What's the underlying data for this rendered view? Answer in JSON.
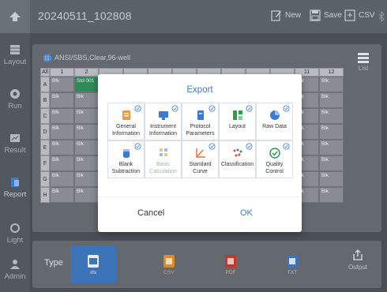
{
  "header": {
    "title": "20240511_102808",
    "new_label": "New",
    "save_label": "Save",
    "csv_label": "CSV"
  },
  "sidebar": {
    "items": [
      {
        "label": "Layout",
        "icon": "layout-icon"
      },
      {
        "label": "Run",
        "icon": "run-icon"
      },
      {
        "label": "Result",
        "icon": "result-icon"
      },
      {
        "label": "Report",
        "icon": "report-icon"
      },
      {
        "label": "Light",
        "icon": "light-icon"
      },
      {
        "label": "Admin",
        "icon": "admin-icon"
      }
    ]
  },
  "plate": {
    "name": "ANSI/SBS,Clear,96-well",
    "all_label": "All",
    "columns": [
      "1",
      "2",
      "11",
      "12"
    ],
    "rows": [
      "A",
      "B",
      "C",
      "D",
      "E",
      "F",
      "G",
      "H"
    ],
    "a2_text": "Std 001",
    "blank_text": "Blk",
    "list_label": "List"
  },
  "bottom": {
    "type_label": "Type",
    "types": [
      {
        "label": "xls"
      },
      {
        "label": "CSV"
      },
      {
        "label": "PDF"
      },
      {
        "label": "TXT"
      }
    ],
    "output_label": "Output"
  },
  "modal": {
    "title": "Export",
    "tiles": [
      {
        "label": "General Information"
      },
      {
        "label": "Instrument Information"
      },
      {
        "label": "Protocol Parameters"
      },
      {
        "label": "Layout"
      },
      {
        "label": "Raw Data"
      },
      {
        "label": "Blank Subtraction"
      },
      {
        "label": "Basic Calculation"
      },
      {
        "label": "Standard Curve"
      },
      {
        "label": "Classification"
      },
      {
        "label": "Quality Control"
      }
    ],
    "cancel_label": "Cancel",
    "ok_label": "OK"
  },
  "colors": {
    "accent": "#3a7bd5",
    "excel_green": "#2e8b57",
    "csv_orange": "#d98b2f",
    "pdf_red": "#c0392b",
    "red_well": "#b22222"
  }
}
